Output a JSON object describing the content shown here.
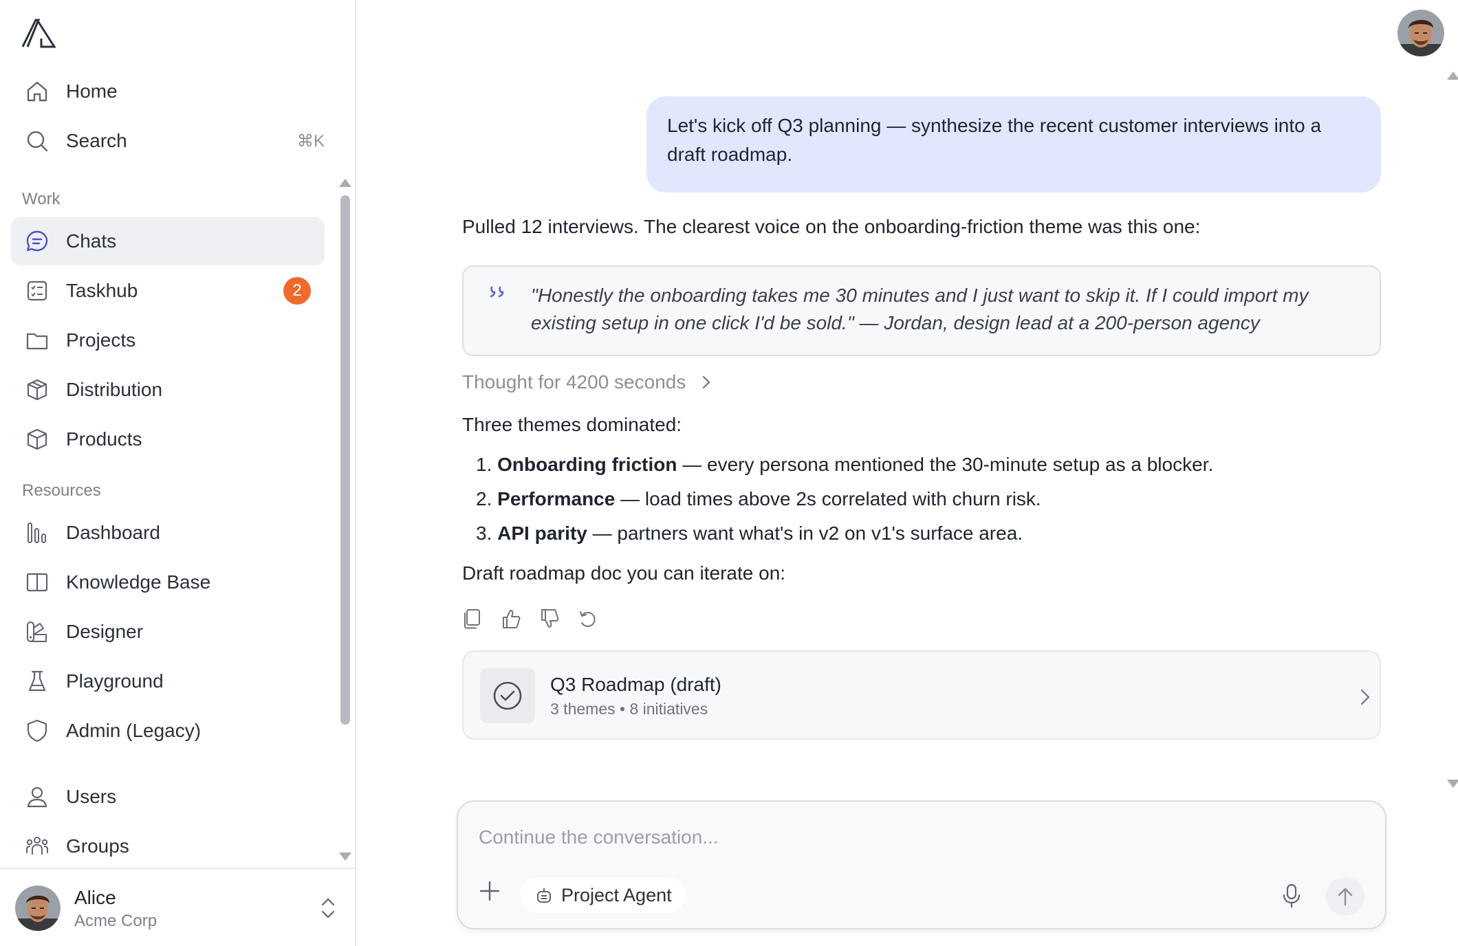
{
  "sidebar": {
    "top_items": [
      {
        "label": "Home",
        "icon": "home-icon"
      },
      {
        "label": "Search",
        "icon": "search-icon",
        "shortcut": "⌘K"
      }
    ],
    "work_label": "Work",
    "work_items": [
      {
        "label": "Chats",
        "icon": "chat-icon",
        "active": true
      },
      {
        "label": "Taskhub",
        "icon": "checklist-icon",
        "badge": "2"
      },
      {
        "label": "Projects",
        "icon": "folder-icon"
      },
      {
        "label": "Distribution",
        "icon": "box-icon"
      },
      {
        "label": "Products",
        "icon": "box-icon"
      }
    ],
    "resources_label": "Resources",
    "resource_items": [
      {
        "label": "Dashboard",
        "icon": "bar-chart-icon"
      },
      {
        "label": "Knowledge Base",
        "icon": "book-icon"
      },
      {
        "label": "Designer",
        "icon": "palette-icon"
      },
      {
        "label": "Playground",
        "icon": "flask-icon"
      },
      {
        "label": "Admin (Legacy)",
        "icon": "shield-icon"
      }
    ],
    "admin_items": [
      {
        "label": "Users",
        "icon": "user-icon"
      },
      {
        "label": "Groups",
        "icon": "group-icon"
      }
    ],
    "user": {
      "name": "Alice",
      "org": "Acme Corp"
    }
  },
  "chat": {
    "user_message": "Let's kick off Q3 planning — synthesize the recent customer interviews into a draft roadmap.",
    "response_intro": "Pulled 12 interviews. The clearest voice on the onboarding-friction theme was this one:",
    "quote": "\"Honestly the onboarding takes me 30 minutes and I just want to skip it. If I could import my existing setup in one click I'd be sold.\" — Jordan, design lead at a 200-person agency",
    "thought": "Thought for 4200 seconds",
    "themes_intro": "Three themes dominated:",
    "themes": [
      {
        "num": "1.",
        "title": "Onboarding friction",
        "text": " — every persona mentioned the 30-minute setup as a blocker."
      },
      {
        "num": "2.",
        "title": "Performance",
        "text": " — load times above 2s correlated with churn risk."
      },
      {
        "num": "3.",
        "title": "API parity",
        "text": " — partners want what's in v2 on v1's surface area."
      }
    ],
    "doc_intro": "Draft roadmap doc you can iterate on:",
    "artifact": {
      "title": "Q3 Roadmap (draft)",
      "meta": "3 themes • 8 initiatives"
    }
  },
  "composer": {
    "placeholder": "Continue the conversation...",
    "agent_label": "Project Agent"
  },
  "colors": {
    "accent_bubble": "#e2e7fd",
    "badge": "#f06a2c",
    "quote_mark": "#5b62d6"
  }
}
